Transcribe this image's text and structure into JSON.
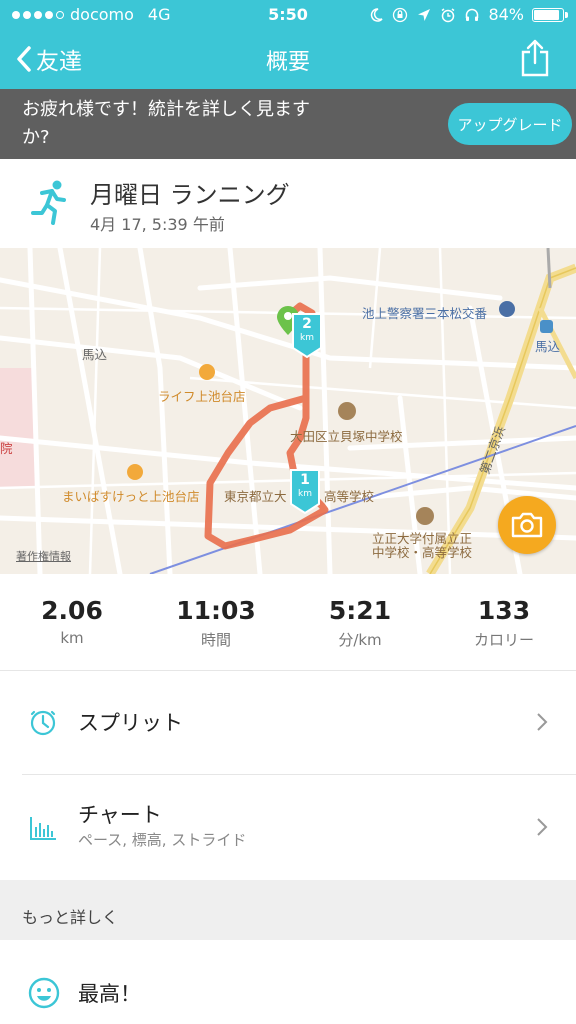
{
  "status_bar": {
    "carrier": "docomo",
    "network": "4G",
    "time": "5:50",
    "battery": "84%"
  },
  "nav": {
    "back_label": "友達",
    "title": "概要"
  },
  "banner": {
    "message": "お疲れ様です！統計を詳しく見ますか?",
    "upgrade_label": "アップグレード"
  },
  "activity": {
    "name": "月曜日 ランニング",
    "date": "4月 17, 5:39 午前"
  },
  "map": {
    "labels": {
      "police": "池上警察署三本松交番",
      "station": "馬込",
      "area": "馬込",
      "life": "ライフ上池台店",
      "school1": "大田区立貝塚中学校",
      "maibasuketto": "まいばすけっと上池台店",
      "school2": "東京都立大",
      "school2b": "高等学校",
      "rissho1": "立正大学付属立正",
      "rissho2": "中学校・高等学校",
      "road": "第二京浜",
      "copyright": "著作権情報",
      "hospital": "院"
    },
    "markers": [
      {
        "km": "2",
        "unit": "km"
      },
      {
        "km": "1",
        "unit": "km"
      }
    ]
  },
  "stats": [
    {
      "value": "2.06",
      "unit": "km"
    },
    {
      "value": "11:03",
      "unit": "時間"
    },
    {
      "value": "5:21",
      "unit": "分/km"
    },
    {
      "value": "133",
      "unit": "カロリー"
    }
  ],
  "rows": {
    "splits": {
      "title": "スプリット"
    },
    "charts": {
      "title": "チャート",
      "subtitle": "ペース, 標高, ストライド"
    }
  },
  "more": {
    "title": "もっと詳しく",
    "feeling": "最高！"
  },
  "colors": {
    "accent": "#3cc6d6",
    "route": "#e8714f",
    "camera": "#f5a91f",
    "banner": "#5f5f5f"
  }
}
